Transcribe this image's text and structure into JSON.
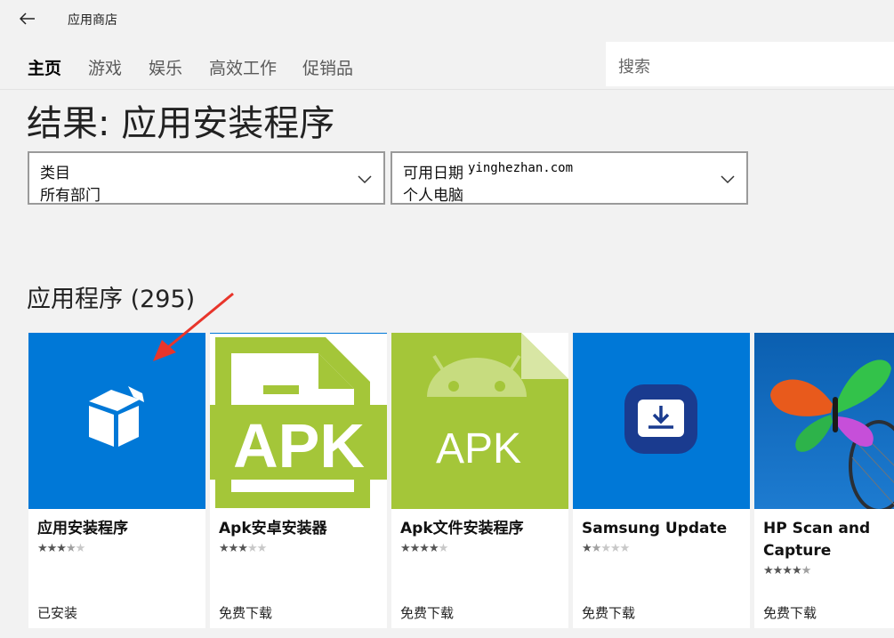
{
  "window": {
    "title": "应用商店"
  },
  "nav": {
    "tabs": [
      {
        "label": "主页",
        "active": true
      },
      {
        "label": "游戏",
        "active": false
      },
      {
        "label": "娱乐",
        "active": false
      },
      {
        "label": "高效工作",
        "active": false
      },
      {
        "label": "促销品",
        "active": false
      }
    ],
    "search_placeholder": "搜索"
  },
  "results": {
    "title": "结果: 应用安装程序",
    "filters": [
      {
        "label": "类目",
        "value": "所有部门"
      },
      {
        "label": "可用日期",
        "value": "个人电脑"
      }
    ],
    "watermark": "yinghezhan.com",
    "section": {
      "title": "应用程序",
      "count": "(295)"
    }
  },
  "apps": [
    {
      "name": "应用安装程序",
      "rating": 3.5,
      "status": "已安装",
      "icon": "box-icon",
      "bg": "#0078d7"
    },
    {
      "name": "Apk安卓安装器",
      "rating": 3,
      "status": "免费下载",
      "icon": "apk-document-icon",
      "bg": "#ffffff"
    },
    {
      "name": "Apk文件安装程序",
      "rating": 4,
      "status": "免费下载",
      "icon": "android-apk-icon",
      "bg": "#ffffff"
    },
    {
      "name": "Samsung Update",
      "rating": 1.5,
      "status": "免费下载",
      "icon": "download-icon",
      "bg": "#0078d7"
    },
    {
      "name": "HP Scan and Capture",
      "rating": 4.5,
      "status": "免费下载",
      "icon": "butterfly-net-icon",
      "bg": "#1a6fbf"
    }
  ],
  "colors": {
    "accent": "#0078d7",
    "apk_green": "#a4c639",
    "annotation_red": "#e8352b"
  }
}
